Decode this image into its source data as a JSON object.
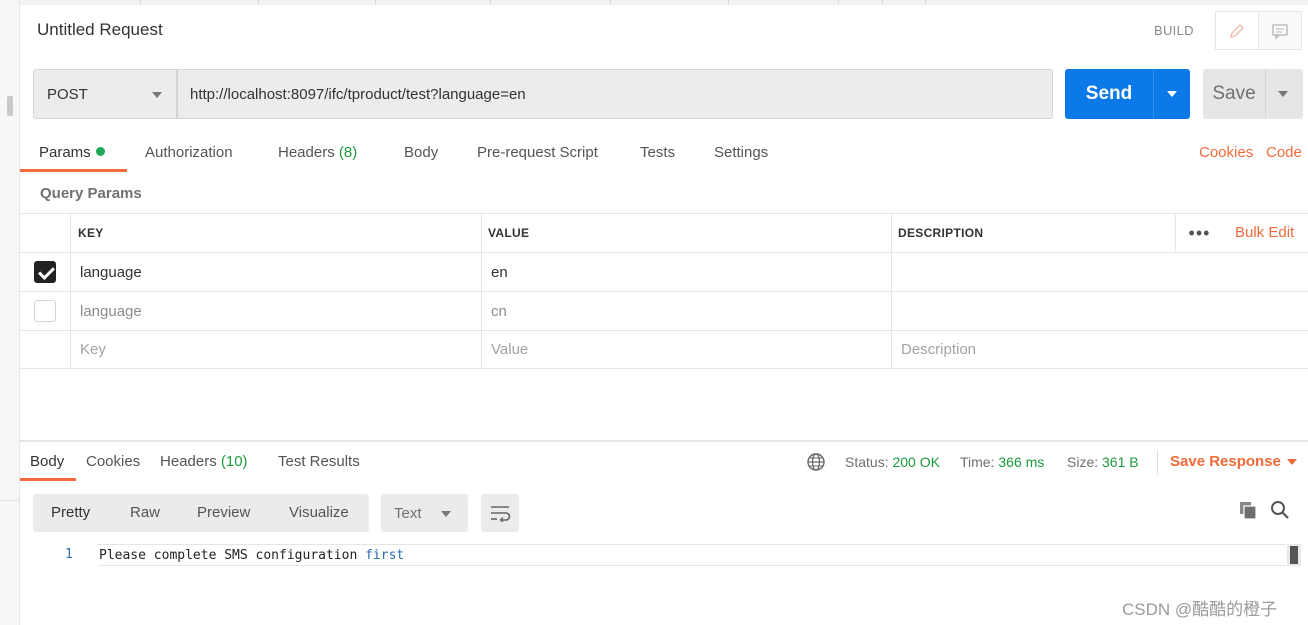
{
  "request": {
    "title": "Untitled Request",
    "mode_label": "BUILD",
    "method": "POST",
    "url": "http://localhost:8097/ifc/tproduct/test?language=en",
    "send_label": "Send",
    "save_label": "Save"
  },
  "request_tabs": {
    "params": "Params",
    "authorization": "Authorization",
    "headers": "Headers",
    "headers_count": "(8)",
    "body": "Body",
    "pre_request": "Pre-request Script",
    "tests": "Tests",
    "settings": "Settings",
    "cookies": "Cookies",
    "code": "Code"
  },
  "query_params": {
    "section_label": "Query Params",
    "columns": {
      "key": "KEY",
      "value": "VALUE",
      "description": "DESCRIPTION"
    },
    "more_label": "•••",
    "bulk_edit_label": "Bulk Edit",
    "rows": [
      {
        "checked": true,
        "key": "language",
        "value": "en",
        "description": ""
      },
      {
        "checked": false,
        "key": "language",
        "value": "cn",
        "description": ""
      }
    ],
    "placeholders": {
      "key": "Key",
      "value": "Value",
      "description": "Description"
    }
  },
  "response": {
    "tabs": {
      "body": "Body",
      "cookies": "Cookies",
      "headers": "Headers",
      "headers_count": "(10)",
      "test_results": "Test Results"
    },
    "status_label": "Status:",
    "status_value": "200 OK",
    "time_label": "Time:",
    "time_value": "366 ms",
    "size_label": "Size:",
    "size_value": "361 B",
    "save_response_label": "Save Response",
    "formats": {
      "pretty": "Pretty",
      "raw": "Raw",
      "preview": "Preview",
      "visualize": "Visualize"
    },
    "type_select": "Text",
    "body_lines": [
      {
        "number": "1",
        "text_main": "Please complete SMS configuration ",
        "text_highlight": "first"
      }
    ]
  },
  "watermark": "CSDN @酷酷的橙子",
  "colors": {
    "accent_orange": "#f26b3a",
    "send_blue": "#0b7ae8",
    "success_green": "#1c9b3c"
  }
}
